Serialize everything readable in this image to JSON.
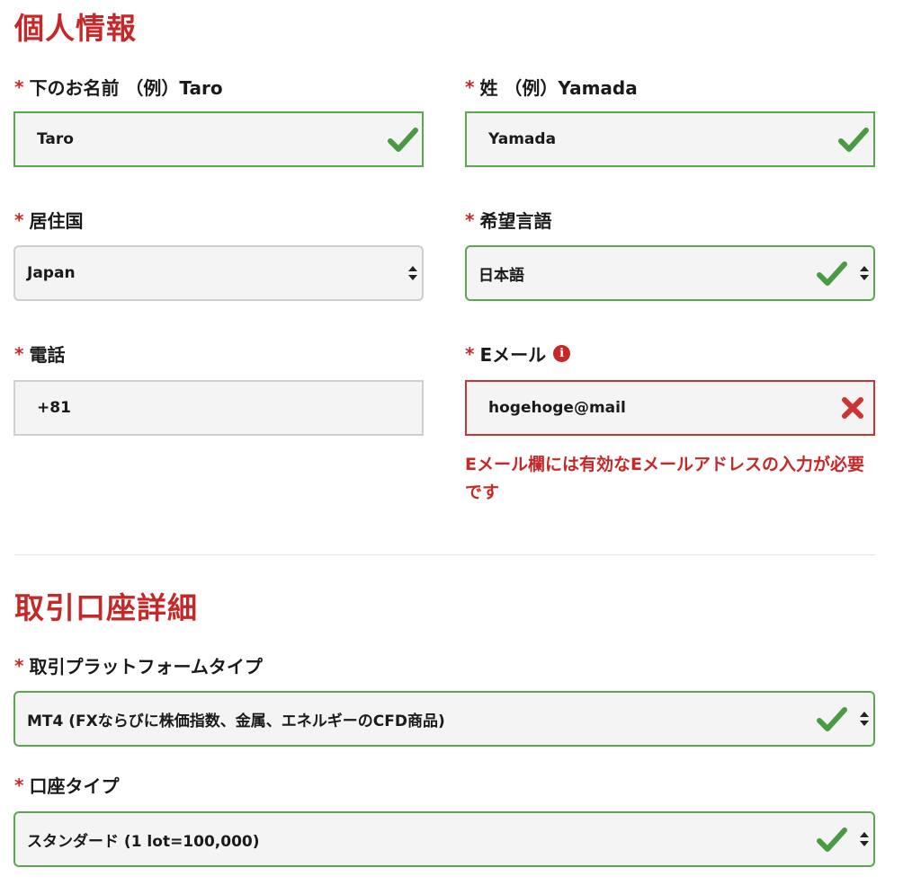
{
  "personal_info": {
    "title": "個人情報",
    "first_name": {
      "label": "下のお名前 （例）Taro",
      "value": "Taro"
    },
    "last_name": {
      "label": "姓 （例）Yamada",
      "value": "Yamada"
    },
    "country": {
      "label": "居住国",
      "value": "Japan"
    },
    "language": {
      "label": "希望言語",
      "value": "日本語"
    },
    "phone": {
      "label": "電話",
      "value": "+81"
    },
    "email": {
      "label": "Eメール",
      "value": "hogehoge@mail",
      "error": "Eメール欄には有効なEメールアドレスの入力が必要です"
    }
  },
  "account_details": {
    "title": "取引口座詳細",
    "platform": {
      "label": "取引プラットフォームタイプ",
      "value": "MT4 (FXならびに株価指数、金属、エネルギーのCFD商品)"
    },
    "account_type": {
      "label": "口座タイプ",
      "value": "スタンダード (1 lot=100,000)"
    }
  },
  "required_marker": "*",
  "info_glyph": "i",
  "icons": {
    "valid": "checkmark-icon",
    "invalid": "cross-icon",
    "select": "sort-arrows-icon",
    "info": "info-circle-icon"
  },
  "colors": {
    "accent_red": "#c62828",
    "valid_green": "#5aa84e",
    "check_green": "#4a9a44",
    "error_border": "#cc3333",
    "field_bg": "#f4f4f4"
  }
}
